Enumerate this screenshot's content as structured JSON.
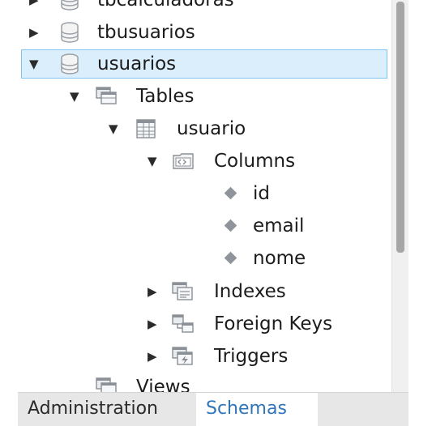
{
  "tree": {
    "items": [
      {
        "label": "tbcalculadoras",
        "icon": "database-icon",
        "expanded": false
      },
      {
        "label": "tbusuarios",
        "icon": "database-icon",
        "expanded": false
      },
      {
        "label": "usuarios",
        "icon": "database-icon",
        "expanded": true,
        "selected": true
      },
      {
        "label": "Tables",
        "icon": "tables-folder-icon",
        "expanded": true
      },
      {
        "label": "usuario",
        "icon": "table-icon",
        "expanded": true
      },
      {
        "label": "Columns",
        "icon": "columns-folder-icon",
        "expanded": true
      },
      {
        "label": "id",
        "icon": "column-icon"
      },
      {
        "label": "email",
        "icon": "column-icon"
      },
      {
        "label": "nome",
        "icon": "column-icon"
      },
      {
        "label": "Indexes",
        "icon": "indexes-folder-icon",
        "expanded": false
      },
      {
        "label": "Foreign Keys",
        "icon": "foreign-keys-folder-icon",
        "expanded": false
      },
      {
        "label": "Triggers",
        "icon": "triggers-folder-icon",
        "expanded": false
      },
      {
        "label": "Views",
        "icon": "views-folder-icon",
        "expanded": false
      }
    ]
  },
  "tabs": [
    {
      "label": "Administration",
      "active": false
    },
    {
      "label": "Schemas",
      "active": true
    }
  ],
  "colors": {
    "selection_bg": "#dbeefb",
    "selection_border": "#86c2ee",
    "active_tab_text": "#2f76b8"
  }
}
